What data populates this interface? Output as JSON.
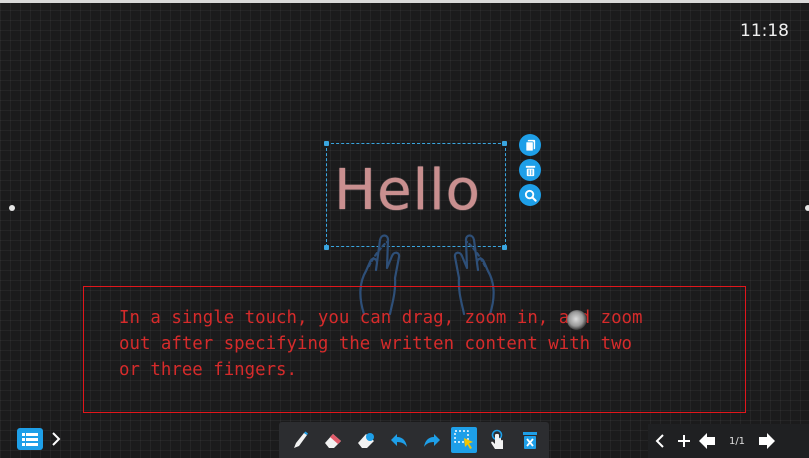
{
  "status": {
    "clock": "11:18"
  },
  "canvas": {
    "selected_text": "Hello",
    "side_actions": [
      {
        "icon": "copy-icon"
      },
      {
        "icon": "delete-icon"
      },
      {
        "icon": "zoom-icon"
      }
    ]
  },
  "caption": {
    "lines": [
      "In a single touch, you can drag, zoom in, and zoom",
      "out after specifying the written content with two",
      "or three fingers."
    ]
  },
  "toolbar": {
    "tools": [
      {
        "icon": "pen-icon"
      },
      {
        "icon": "eraser-icon"
      },
      {
        "icon": "erase-area-icon"
      },
      {
        "icon": "undo-icon"
      },
      {
        "icon": "redo-icon"
      },
      {
        "icon": "select-icon",
        "active": true
      },
      {
        "icon": "touch-roam-icon"
      },
      {
        "icon": "clear-icon"
      }
    ]
  },
  "pager": {
    "page_indicator": "1/1"
  },
  "colors": {
    "accent": "#1e9fe8",
    "caption_red": "#e2161b",
    "hello_text": "#c98f8f",
    "background": "#1b1b1c"
  }
}
